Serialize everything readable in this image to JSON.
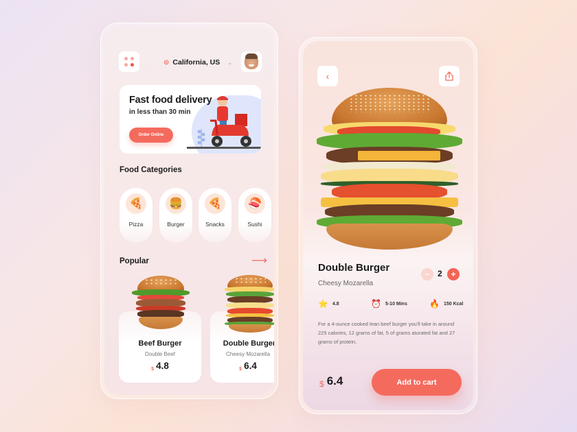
{
  "home": {
    "header": {
      "menu_icon": "grid-dots-icon",
      "location": "California, US",
      "location_icon": "map-pin-icon",
      "dropdown_icon": "chevron-down-icon",
      "avatar": "user-avatar"
    },
    "promo": {
      "title": "Fast food delivery",
      "subtitle": "in less than 30 min",
      "button_label": "Order Online",
      "illustration": "delivery-scooter-illustration"
    },
    "categories": {
      "title": "Food Categories",
      "items": [
        {
          "label": "Pizza",
          "icon": "🍕"
        },
        {
          "label": "Burger",
          "icon": "🍔"
        },
        {
          "label": "Snacks",
          "icon": "🍕"
        },
        {
          "label": "Sushi",
          "icon": "🍣"
        }
      ]
    },
    "popular": {
      "title": "Popular",
      "arrow_icon": "arrow-right-icon",
      "items": [
        {
          "name": "Beef Burger",
          "desc": "Double Beef",
          "currency": "$",
          "price": "4.8"
        },
        {
          "name": "Double Burger",
          "desc": "Cheesy Mozarella",
          "currency": "$",
          "price": "6.4"
        }
      ]
    }
  },
  "detail": {
    "back_icon": "chevron-left-icon",
    "share_icon": "share-icon",
    "title": "Double Burger",
    "subtitle": "Cheesy Mozarella",
    "quantity": "2",
    "minus": "−",
    "plus": "+",
    "stats": [
      {
        "icon": "⭐",
        "value": "4.8"
      },
      {
        "icon": "⏰",
        "value": "5-10 Mins"
      },
      {
        "icon": "🔥",
        "value": "150 Kcal"
      }
    ],
    "description": " For a 4-ounce cooked lean beef burger you'll take in around 225 calories, 12 grams of fat, 5 of grams aturated fat and 27 grams of protein.",
    "currency": "$",
    "price": "6.4",
    "cart_label": "Add to cart"
  },
  "colors": {
    "accent": "#f46b5e",
    "accent_light": "#fbd5cf",
    "category_circle": "#fde5d9"
  }
}
